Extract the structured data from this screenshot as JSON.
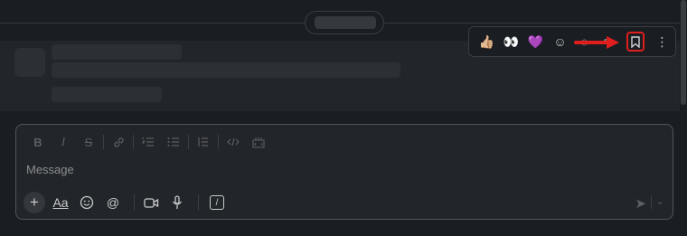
{
  "composer": {
    "placeholder": "Message",
    "format_buttons": [
      {
        "name": "bold",
        "glyph": "B"
      },
      {
        "name": "italic",
        "glyph": "I"
      },
      {
        "name": "strikethrough",
        "glyph": "S"
      },
      {
        "name": "link",
        "glyph": "🔗"
      },
      {
        "name": "ordered-list",
        "glyph": "≔"
      },
      {
        "name": "bulleted-list",
        "glyph": "☰"
      },
      {
        "name": "blockquote",
        "glyph": "⁝"
      },
      {
        "name": "code",
        "glyph": "</>"
      },
      {
        "name": "code-block",
        "glyph": "⌨"
      }
    ],
    "actions": {
      "plus": "+",
      "formatting": "Aa",
      "emoji": "☺",
      "mention": "@",
      "video": "▭",
      "audio": "🎙",
      "shortcut": "/"
    },
    "send": "➤",
    "send_options": "⌄"
  },
  "hover_toolbar": {
    "reactions": [
      "👍🏼",
      "👀",
      "💜"
    ],
    "add_reaction": "☺",
    "reply_thread": "◌",
    "forward": "↪",
    "save": "🔖",
    "more": "⋮"
  }
}
